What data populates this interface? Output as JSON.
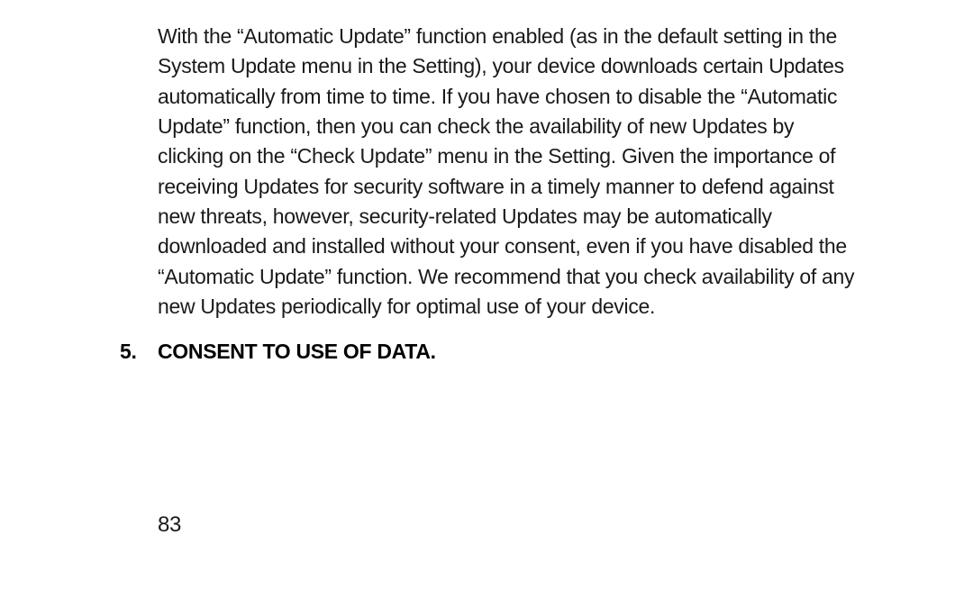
{
  "document": {
    "paragraph": "With the “Automatic Update” function enabled (as in the default setting in the System Update menu in the Setting), your device downloads certain Updates automatically from time to time. If you have chosen  to disable the “Automatic Update” function, then you can check the availability of new Updates by clicking on the “Check Update” menu in the Setting.  Given the importance of receiving Updates for security software in a timely manner to defend against new threats, however, security-related Updates may be automatically downloaded and installed without your consent, even if you have disabled the “Automatic Update” function. We recommend that you check availability of any new Updates periodically for optimal use of your device.",
    "section": {
      "number": "5.",
      "title": "CONSENT TO USE OF DATA."
    },
    "page_number": "83"
  }
}
